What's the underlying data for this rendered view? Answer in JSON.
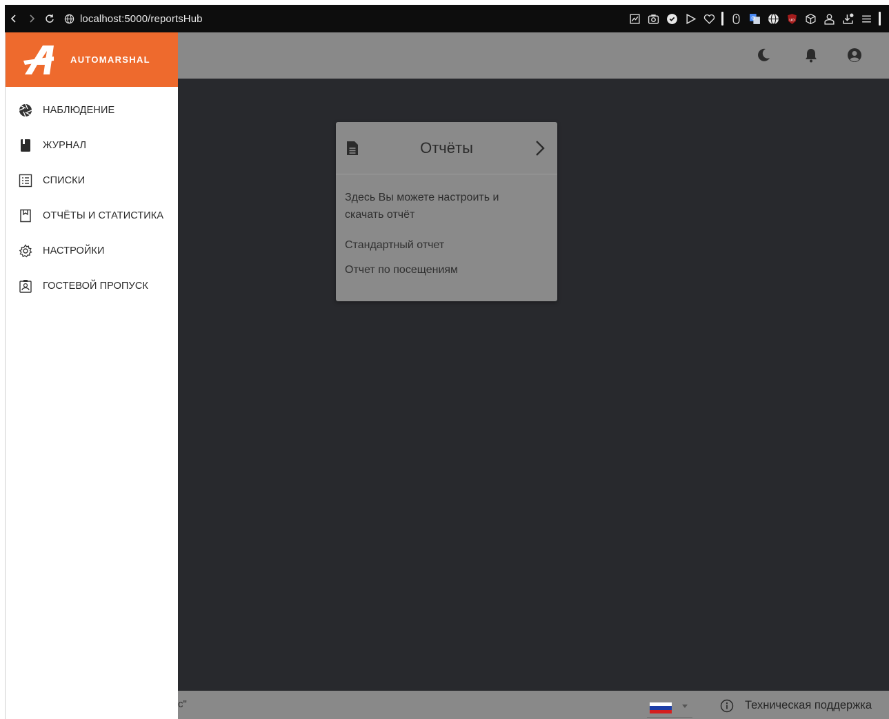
{
  "browser": {
    "url": "localhost:5000/reportsHub",
    "extension_icons": [
      "chart-edit-icon",
      "camera-icon",
      "shield-check-icon",
      "play-icon",
      "heart-icon",
      "mouse-icon",
      "translate-icon",
      "globe-icon",
      "ublock-icon",
      "cube-icon",
      "person-icon",
      "download-icon",
      "menu-icon"
    ]
  },
  "brand": {
    "name": "AUTOMARSHAL",
    "color": "#ee6a2d"
  },
  "sidebar": {
    "items": [
      {
        "label": "НАБЛЮДЕНИЕ",
        "icon": "aperture-icon"
      },
      {
        "label": "ЖУРНАЛ",
        "icon": "book-icon"
      },
      {
        "label": "СПИСКИ",
        "icon": "list-icon"
      },
      {
        "label": "ОТЧЁТЫ И СТАТИСТИКА",
        "icon": "report-icon"
      },
      {
        "label": "НАСТРОЙКИ",
        "icon": "gear-icon"
      },
      {
        "label": "ГОСТЕВОЙ ПРОПУСК",
        "icon": "badge-icon"
      }
    ]
  },
  "header": {
    "icons": [
      "moon-icon",
      "bell-icon",
      "user-circle-icon"
    ]
  },
  "card": {
    "title": "Отчёты",
    "description": "Здесь Вы можете настроить и скачать отчёт",
    "links": [
      "Стандартный отчет",
      "Отчет по посещениям"
    ]
  },
  "footer": {
    "left_fragment": "c\"",
    "language_flag": "ru-flag-icon",
    "support_label": "Техническая поддержка"
  }
}
